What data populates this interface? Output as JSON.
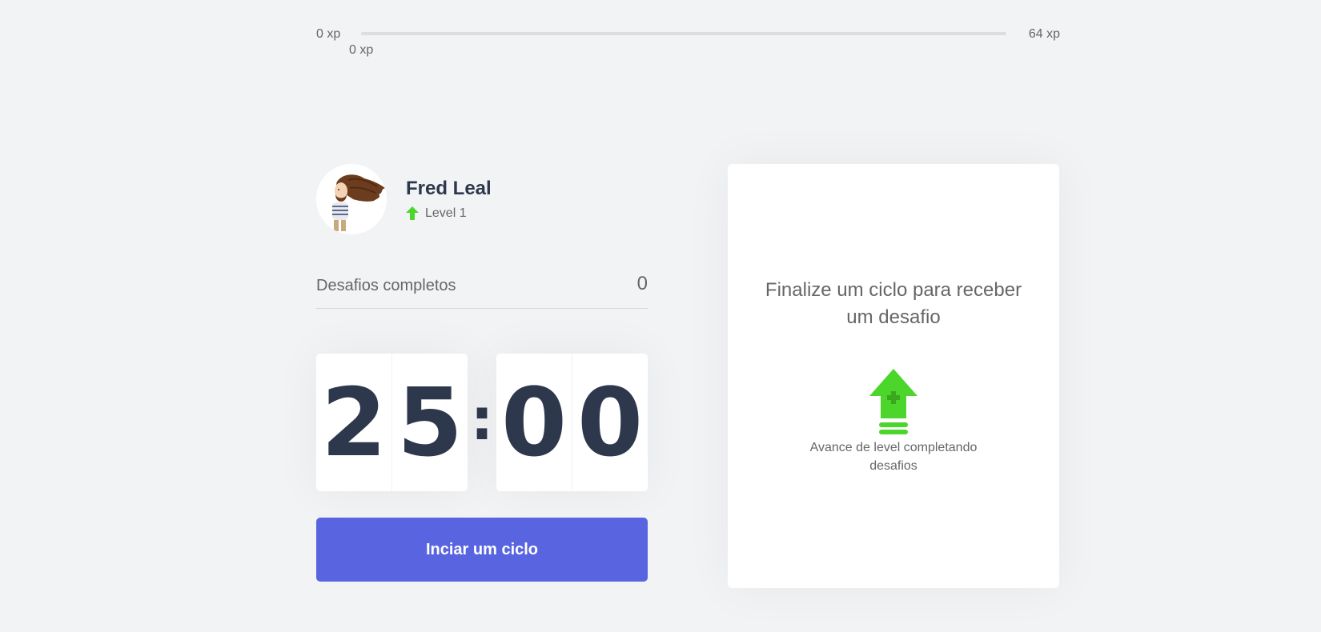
{
  "experience": {
    "min_label": "0 xp",
    "max_label": "64 xp",
    "current_label": "0 xp",
    "progress_percent": 0,
    "accent_color": "#4cd62b"
  },
  "profile": {
    "name": "Fred Leal",
    "level_label": "Level 1",
    "avatar_icon": "avatar-illustration",
    "level_icon": "level-up-arrow-icon"
  },
  "completed_challenges": {
    "label": "Desafios completos",
    "count": "0"
  },
  "countdown": {
    "minute_left": "2",
    "minute_right": "5",
    "separator": ":",
    "second_left": "0",
    "second_right": "0"
  },
  "start_button": {
    "label": "Inciar um ciclo",
    "color": "#5965e0"
  },
  "challenge_box": {
    "title": "Finalize um ciclo para receber um desafio",
    "hint": "Avance de level completando desafios",
    "icon": "level-up-icon"
  }
}
